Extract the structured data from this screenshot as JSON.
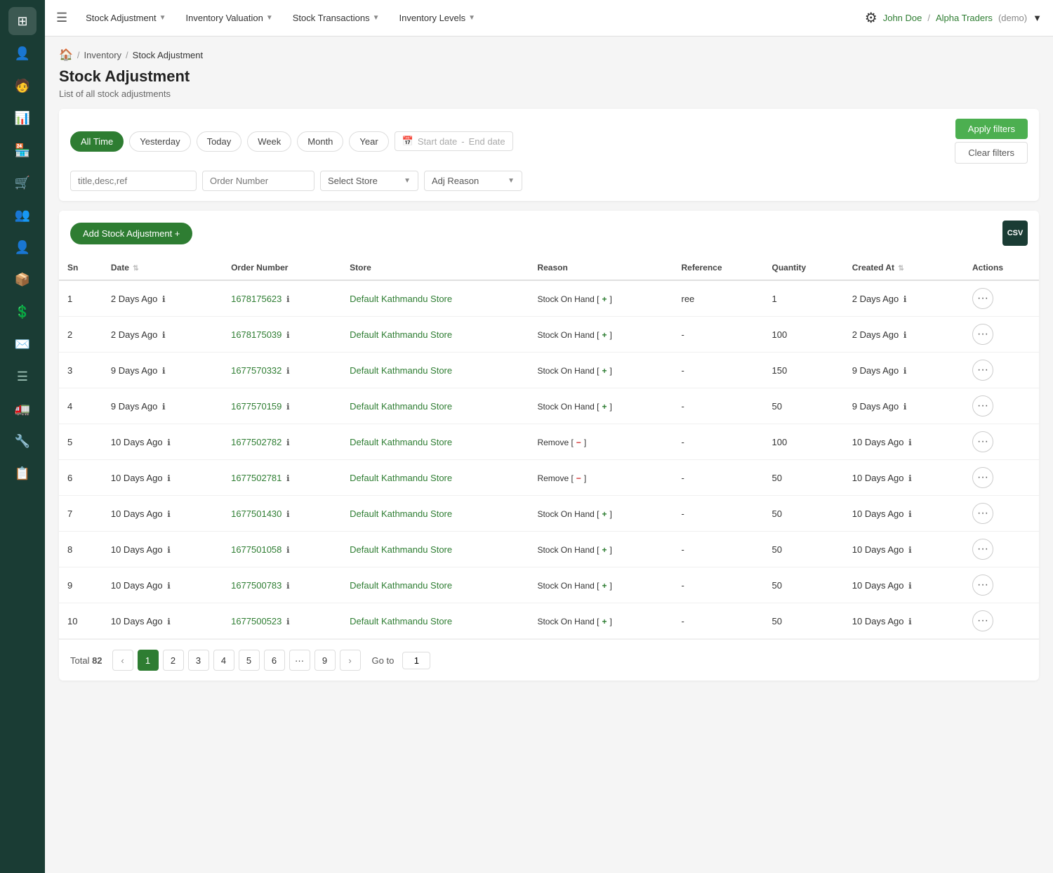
{
  "sidebar": {
    "icons": [
      {
        "name": "dashboard-icon",
        "symbol": "⊞"
      },
      {
        "name": "users-icon",
        "symbol": "👤"
      },
      {
        "name": "person-icon",
        "symbol": "🧑"
      },
      {
        "name": "chart-icon",
        "symbol": "📈"
      },
      {
        "name": "store-icon",
        "symbol": "🏪"
      },
      {
        "name": "cart-icon",
        "symbol": "🛒"
      },
      {
        "name": "team-icon",
        "symbol": "👥"
      },
      {
        "name": "user-profile-icon",
        "symbol": "👤"
      },
      {
        "name": "box-icon",
        "symbol": "📦"
      },
      {
        "name": "dollar-icon",
        "symbol": "$"
      },
      {
        "name": "mail-icon",
        "symbol": "✉"
      },
      {
        "name": "list-icon",
        "symbol": "☰"
      },
      {
        "name": "truck-icon",
        "symbol": "🚛"
      },
      {
        "name": "tools-icon",
        "symbol": "🔧"
      },
      {
        "name": "tasks-icon",
        "symbol": "📋"
      }
    ]
  },
  "topnav": {
    "menu_icon": "☰",
    "items": [
      {
        "label": "Stock Adjustment",
        "has_chevron": true
      },
      {
        "label": "Inventory Valuation",
        "has_chevron": true
      },
      {
        "label": "Stock Transactions",
        "has_chevron": true
      },
      {
        "label": "Inventory Levels",
        "has_chevron": true
      }
    ],
    "user": {
      "name": "John Doe",
      "separator": "/",
      "company": "Alpha Traders",
      "badge": "(demo)"
    }
  },
  "breadcrumb": {
    "home": "🏠",
    "items": [
      "Inventory",
      "Stock Adjustment"
    ]
  },
  "page": {
    "title": "Stock Adjustment",
    "subtitle": "List of all stock adjustments"
  },
  "filters": {
    "time_buttons": [
      "All Time",
      "Yesterday",
      "Today",
      "Week",
      "Month",
      "Year"
    ],
    "active_time": "All Time",
    "date_placeholder_start": "Start date",
    "date_placeholder_end": "End date",
    "search_placeholder": "title,desc,ref",
    "order_number_placeholder": "Order Number",
    "store_placeholder": "Select Store",
    "adj_reason_placeholder": "Adj Reason",
    "apply_label": "Apply filters",
    "clear_label": "Clear filters"
  },
  "table": {
    "add_button_label": "Add Stock Adjustment +",
    "csv_label": "CSV",
    "columns": [
      "Sn",
      "Date",
      "Order Number",
      "Store",
      "Reason",
      "Reference",
      "Quantity",
      "Created At",
      "Actions"
    ],
    "rows": [
      {
        "sn": 1,
        "date": "2 Days Ago",
        "order_number": "1678175623",
        "store": "Default Kathmandu Store",
        "reason": "Stock On Hand",
        "reason_type": "plus",
        "reference": "ree",
        "quantity": 1,
        "created_at": "2 Days Ago"
      },
      {
        "sn": 2,
        "date": "2 Days Ago",
        "order_number": "1678175039",
        "store": "Default Kathmandu Store",
        "reason": "Stock On Hand",
        "reason_type": "plus",
        "reference": "-",
        "quantity": 100,
        "created_at": "2 Days Ago"
      },
      {
        "sn": 3,
        "date": "9 Days Ago",
        "order_number": "1677570332",
        "store": "Default Kathmandu Store",
        "reason": "Stock On Hand",
        "reason_type": "plus",
        "reference": "-",
        "quantity": 150,
        "created_at": "9 Days Ago"
      },
      {
        "sn": 4,
        "date": "9 Days Ago",
        "order_number": "1677570159",
        "store": "Default Kathmandu Store",
        "reason": "Stock On Hand",
        "reason_type": "plus",
        "reference": "-",
        "quantity": 50,
        "created_at": "9 Days Ago"
      },
      {
        "sn": 5,
        "date": "10 Days Ago",
        "order_number": "1677502782",
        "store": "Default Kathmandu Store",
        "reason": "Remove",
        "reason_type": "minus",
        "reference": "-",
        "quantity": 100,
        "created_at": "10 Days Ago"
      },
      {
        "sn": 6,
        "date": "10 Days Ago",
        "order_number": "1677502781",
        "store": "Default Kathmandu Store",
        "reason": "Remove",
        "reason_type": "minus",
        "reference": "-",
        "quantity": 50,
        "created_at": "10 Days Ago"
      },
      {
        "sn": 7,
        "date": "10 Days Ago",
        "order_number": "1677501430",
        "store": "Default Kathmandu Store",
        "reason": "Stock On Hand",
        "reason_type": "plus",
        "reference": "-",
        "quantity": 50,
        "created_at": "10 Days Ago"
      },
      {
        "sn": 8,
        "date": "10 Days Ago",
        "order_number": "1677501058",
        "store": "Default Kathmandu Store",
        "reason": "Stock On Hand",
        "reason_type": "plus",
        "reference": "-",
        "quantity": 50,
        "created_at": "10 Days Ago"
      },
      {
        "sn": 9,
        "date": "10 Days Ago",
        "order_number": "1677500783",
        "store": "Default Kathmandu Store",
        "reason": "Stock On Hand",
        "reason_type": "plus",
        "reference": "-",
        "quantity": 50,
        "created_at": "10 Days Ago"
      },
      {
        "sn": 10,
        "date": "10 Days Ago",
        "order_number": "1677500523",
        "store": "Default Kathmandu Store",
        "reason": "Stock On Hand",
        "reason_type": "plus",
        "reference": "-",
        "quantity": 50,
        "created_at": "10 Days Ago"
      }
    ]
  },
  "pagination": {
    "total": 82,
    "pages": [
      1,
      2,
      3,
      4,
      5,
      6,
      "...",
      9
    ],
    "current_page": 1,
    "goto_label": "Go to",
    "goto_value": "1"
  }
}
